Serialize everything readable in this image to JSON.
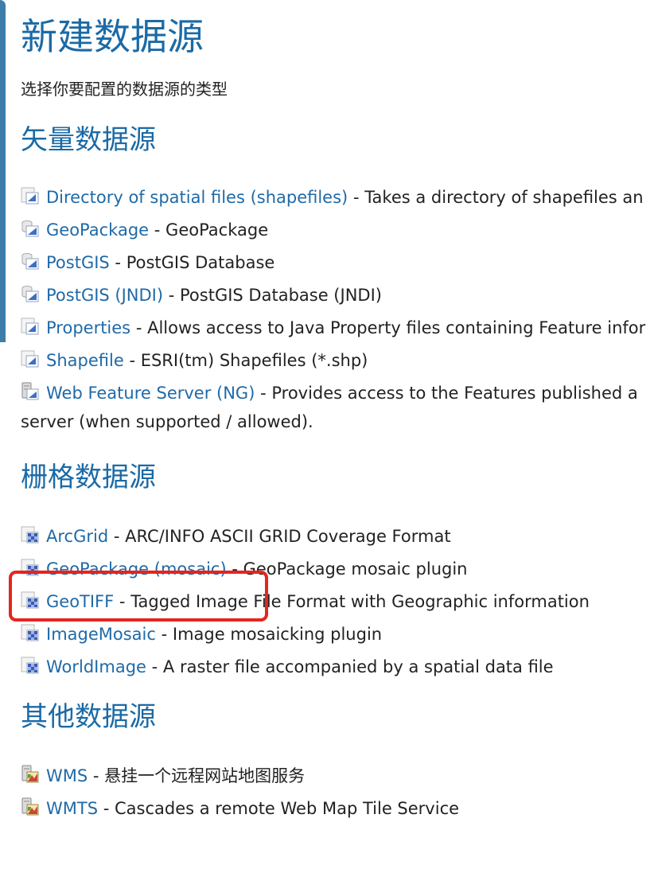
{
  "page": {
    "title": "新建数据源",
    "subtitle": "选择你要配置的数据源的类型"
  },
  "sections": {
    "vector": {
      "title": "矢量数据源",
      "items": [
        {
          "name": "Directory of spatial files (shapefiles)",
          "description": "Takes a directory of shapefiles an",
          "icon": "vector-store-icon"
        },
        {
          "name": "GeoPackage",
          "description": "GeoPackage",
          "icon": "database-store-icon"
        },
        {
          "name": "PostGIS",
          "description": "PostGIS Database",
          "icon": "database-store-icon"
        },
        {
          "name": "PostGIS (JNDI)",
          "description": "PostGIS Database (JNDI)",
          "icon": "database-store-icon"
        },
        {
          "name": "Properties",
          "description": "Allows access to Java Property files containing Feature infor",
          "icon": "vector-store-icon"
        },
        {
          "name": "Shapefile",
          "description": "ESRI(tm) Shapefiles (*.shp)",
          "icon": "vector-store-icon"
        },
        {
          "name": "Web Feature Server (NG)",
          "description": "Provides access to the Features published a server (when supported / allowed).",
          "icon": "server-store-icon"
        }
      ]
    },
    "raster": {
      "title": "栅格数据源",
      "items": [
        {
          "name": "ArcGrid",
          "description": "ARC/INFO ASCII GRID Coverage Format",
          "icon": "raster-store-icon"
        },
        {
          "name": "GeoPackage (mosaic)",
          "description": "GeoPackage mosaic plugin",
          "icon": "raster-store-icon"
        },
        {
          "name": "GeoTIFF",
          "description": "Tagged Image File Format with Geographic information",
          "icon": "raster-store-icon"
        },
        {
          "name": "ImageMosaic",
          "description": "Image mosaicking plugin",
          "icon": "raster-store-icon"
        },
        {
          "name": "WorldImage",
          "description": "A raster file accompanied by a spatial data file",
          "icon": "raster-store-icon"
        }
      ]
    },
    "other": {
      "title": "其他数据源",
      "items": [
        {
          "name": "WMS",
          "description": "悬挂一个远程网站地图服务",
          "icon": "wms-store-icon"
        },
        {
          "name": "WMTS",
          "description": "Cascades a remote Web Map Tile Service",
          "icon": "wms-store-icon"
        }
      ]
    }
  },
  "separator": "-",
  "colors": {
    "heading": "#1b6aa6",
    "link": "#1f6aa8",
    "text": "#222222",
    "highlight": "#e5251f"
  }
}
